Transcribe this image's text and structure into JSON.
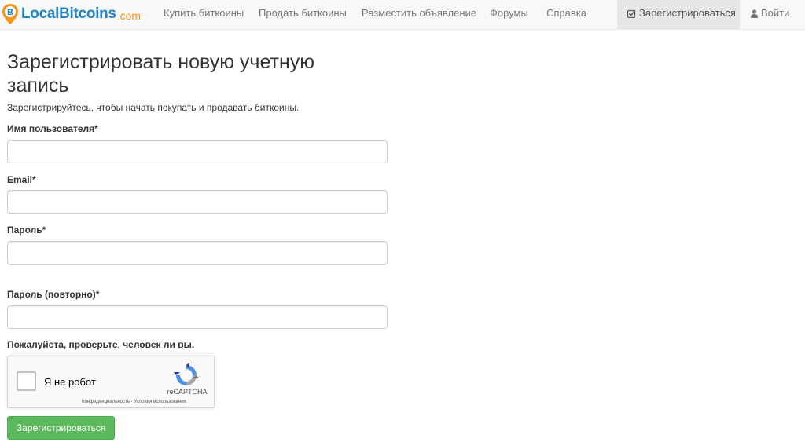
{
  "navbar": {
    "brand_name": "LocalBitcoins",
    "brand_tld": ".com",
    "items": [
      {
        "label": "Купить биткоины"
      },
      {
        "label": "Продать биткоины"
      },
      {
        "label": "Разместить объявление"
      },
      {
        "label": "Форумы"
      },
      {
        "label": "Справка"
      }
    ],
    "register_label": "Зарегистрироваться",
    "login_label": "Войти",
    "register_icon": "check-square-icon",
    "login_icon": "user-icon"
  },
  "form": {
    "title": "Зарегистрировать новую учетную запись",
    "subtitle": "Зарегистрируйтесь, чтобы начать покупать и продавать биткоины.",
    "fields": [
      {
        "label": "Имя пользователя*",
        "value": "",
        "placeholder": ""
      },
      {
        "label": "Email*",
        "value": "",
        "placeholder": ""
      },
      {
        "label": "Пароль*",
        "value": "",
        "placeholder": ""
      },
      {
        "label": "Пароль (повторно)*",
        "value": "",
        "placeholder": ""
      }
    ],
    "captcha_prompt": "Пожалуйста, проверьте, человек ли вы.",
    "submit_label": "Зарегистрироваться"
  },
  "recaptcha": {
    "label": "Я не робот",
    "brand": "reCAPTCHA",
    "terms": "Конфиденциальность - Условия использования"
  },
  "colors": {
    "brand_blue": "#1d86c8",
    "brand_orange": "#f7931a",
    "submit_green": "#5cb85c"
  }
}
